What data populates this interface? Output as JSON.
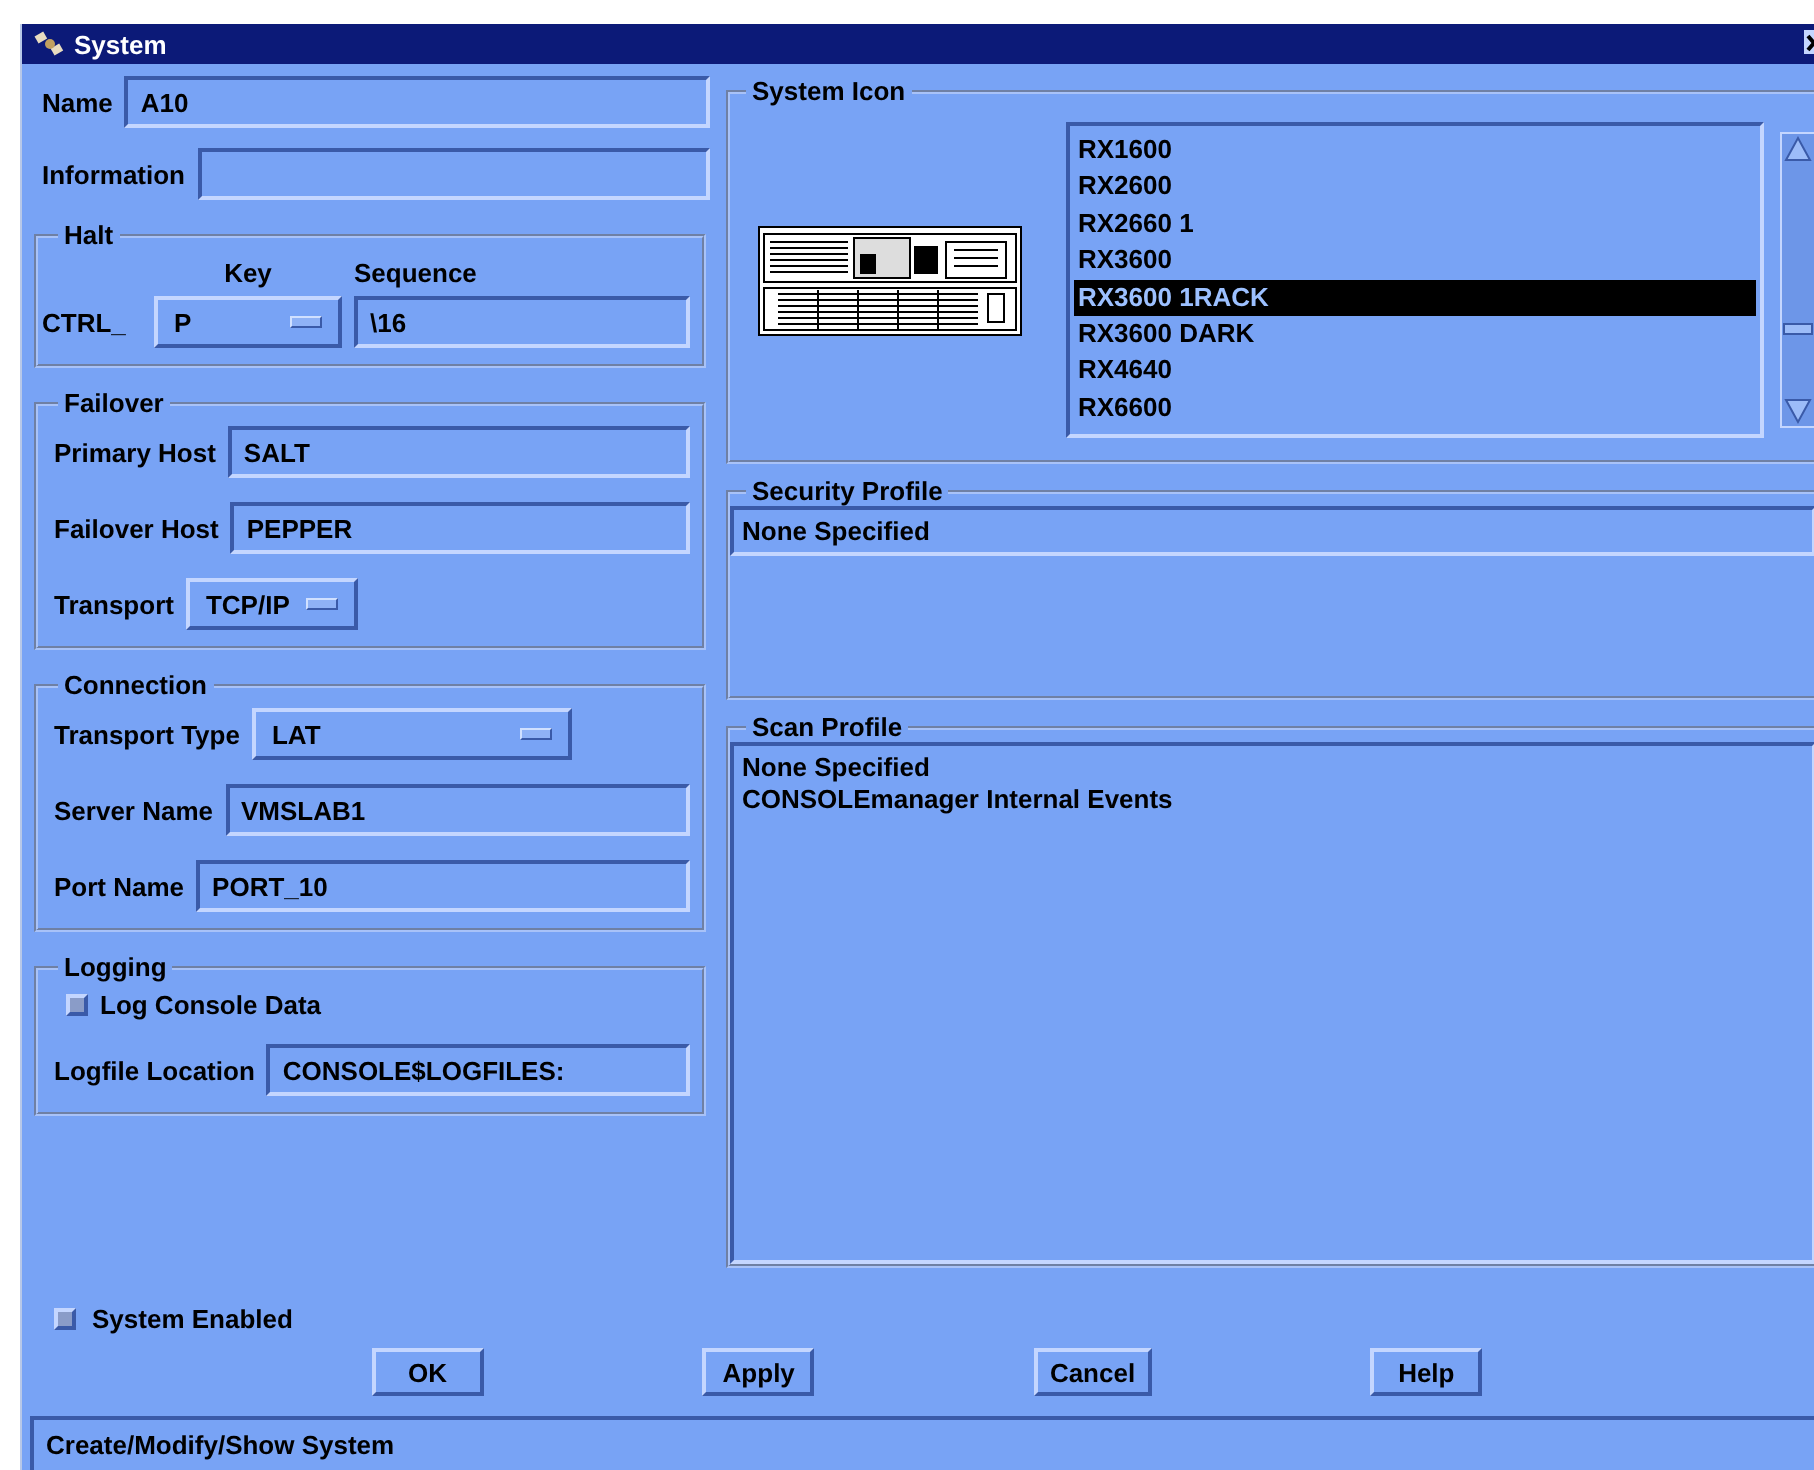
{
  "window": {
    "title": "System"
  },
  "top_fields": [
    {
      "label": "Name",
      "value": "A10"
    },
    {
      "label": "Information"
    }
  ],
  "halt": {
    "title": "Halt",
    "key_label": "Key",
    "sequence_label": "Sequence",
    "prefix": "CTRL_",
    "key": "P",
    "sequence": "\\16"
  },
  "groups": [
    {
      "title": "Failover",
      "rows": [
        {
          "kind": "field",
          "label": "Primary Host",
          "value": "SALT"
        },
        {
          "kind": "field",
          "label": "Failover Host",
          "value": "PEPPER"
        },
        {
          "kind": "menu",
          "label": "Transport",
          "value": "TCP/IP"
        }
      ]
    },
    {
      "title": "Connection",
      "rows": [
        {
          "kind": "menu",
          "label": "Transport Type",
          "value": "LAT"
        },
        {
          "kind": "field",
          "label": "Server Name",
          "value": "VMSLAB1"
        },
        {
          "kind": "field",
          "label": "Port Name",
          "value": "PORT_10"
        }
      ]
    },
    {
      "title": "Logging",
      "rows": [
        {
          "kind": "checkbox",
          "label": "Log Console Data",
          "checked": false
        },
        {
          "kind": "field",
          "label": "Logfile Location",
          "value": "CONSOLE$LOGFILES:"
        }
      ]
    }
  ],
  "system_icon": {
    "title": "System Icon",
    "items": [
      {
        "label": "RX1600",
        "selected": false
      },
      {
        "label": "RX2600",
        "selected": false
      },
      {
        "label": "RX2660 1",
        "selected": false
      },
      {
        "label": "RX3600",
        "selected": false
      },
      {
        "label": "RX3600 1RACK",
        "selected": true
      },
      {
        "label": "RX3600 DARK",
        "selected": false
      },
      {
        "label": "RX4640",
        "selected": false
      },
      {
        "label": "RX6600",
        "selected": false
      }
    ]
  },
  "profiles": [
    {
      "title": "Security Profile",
      "lines": [
        "None Specified"
      ]
    },
    {
      "title": "Scan Profile",
      "lines": [
        "None Specified",
        "CONSOLEmanager Internal Events"
      ]
    }
  ],
  "system_enabled": {
    "label": "System Enabled",
    "checked": false
  },
  "buttons": [
    "OK",
    "Apply",
    "Cancel",
    "Help"
  ],
  "status_bar": "Create/Modify/Show System"
}
